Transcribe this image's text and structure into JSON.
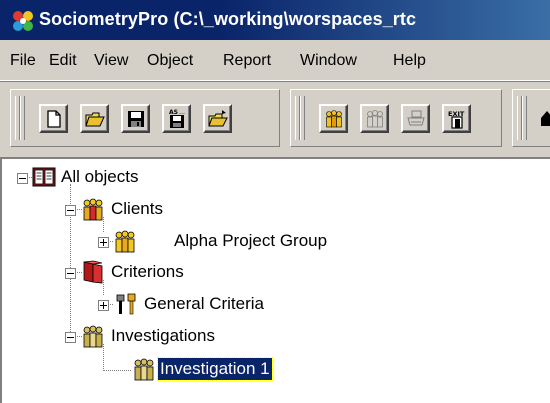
{
  "window": {
    "title": "SociometryPro (C:\\_working\\worspaces_rtc",
    "app_icon": "sociometry-app-icon"
  },
  "menu": {
    "items": [
      "File",
      "Edit",
      "View",
      "Object",
      "Report",
      "Window",
      "Help"
    ]
  },
  "toolbar": {
    "buttons": [
      {
        "icon": "new-document-icon"
      },
      {
        "icon": "open-folder-icon"
      },
      {
        "icon": "save-disk-icon"
      },
      {
        "icon": "save-as-icon"
      },
      {
        "icon": "open-recent-icon"
      },
      {
        "icon": "group-people-icon"
      },
      {
        "icon": "group-people-disabled-icon"
      },
      {
        "icon": "print-icon"
      },
      {
        "icon": "exit-icon"
      },
      {
        "icon": "home-icon"
      }
    ],
    "save_as_caption": "AS",
    "exit_caption": "EXIT"
  },
  "tree": {
    "root": {
      "label": "All objects",
      "icon": "open-book-icon",
      "expanded": true
    },
    "nodes": [
      {
        "label": "Clients",
        "icon": "people-group-icon",
        "expanded": true,
        "level": 1
      },
      {
        "label": "Alpha Project Group",
        "icon": "people-group-icon",
        "expanded": false,
        "level": 2
      },
      {
        "label": "Criterions",
        "icon": "red-folder-icon",
        "expanded": true,
        "level": 1
      },
      {
        "label": "General Criteria",
        "icon": "tools-icon",
        "expanded": false,
        "level": 2
      },
      {
        "label": "Investigations",
        "icon": "people-group-gray-icon",
        "expanded": true,
        "level": 1
      },
      {
        "label": "Investigation 1",
        "icon": "people-group-gray-icon",
        "selected": true,
        "level": 2
      }
    ]
  }
}
